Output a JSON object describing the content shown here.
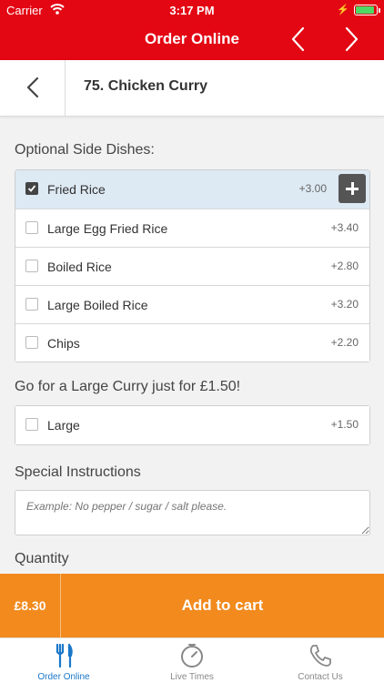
{
  "status_bar": {
    "carrier": "Carrier",
    "time": "3:17 PM"
  },
  "header": {
    "title": "Order Online"
  },
  "item": {
    "title": "75. Chicken Curry"
  },
  "side_dishes": {
    "label": "Optional Side Dishes:",
    "options": [
      {
        "label": "Fried Rice",
        "price": "+3.00",
        "checked": true
      },
      {
        "label": "Large Egg Fried Rice",
        "price": "+3.40",
        "checked": false
      },
      {
        "label": "Boiled Rice",
        "price": "+2.80",
        "checked": false
      },
      {
        "label": "Large Boiled Rice",
        "price": "+3.20",
        "checked": false
      },
      {
        "label": "Chips",
        "price": "+2.20",
        "checked": false
      }
    ]
  },
  "large_curry": {
    "label": "Go for a Large Curry just for £1.50!",
    "options": [
      {
        "label": "Large",
        "price": "+1.50",
        "checked": false
      }
    ]
  },
  "instructions": {
    "label": "Special Instructions",
    "placeholder": "Example: No pepper / sugar / salt please."
  },
  "quantity": {
    "label": "Quantity"
  },
  "cart": {
    "price": "£8.30",
    "add_label": "Add to cart"
  },
  "tabs": [
    {
      "label": "Order Online",
      "icon": "cutlery-icon",
      "active": true
    },
    {
      "label": "Live Times",
      "icon": "timer-icon",
      "active": false
    },
    {
      "label": "Contact Us",
      "icon": "phone-icon",
      "active": false
    }
  ],
  "colors": {
    "brand": "#e30613",
    "cart": "#f28a1e",
    "active_tab": "#1a77c9",
    "selected_row": "#dde9f3"
  }
}
